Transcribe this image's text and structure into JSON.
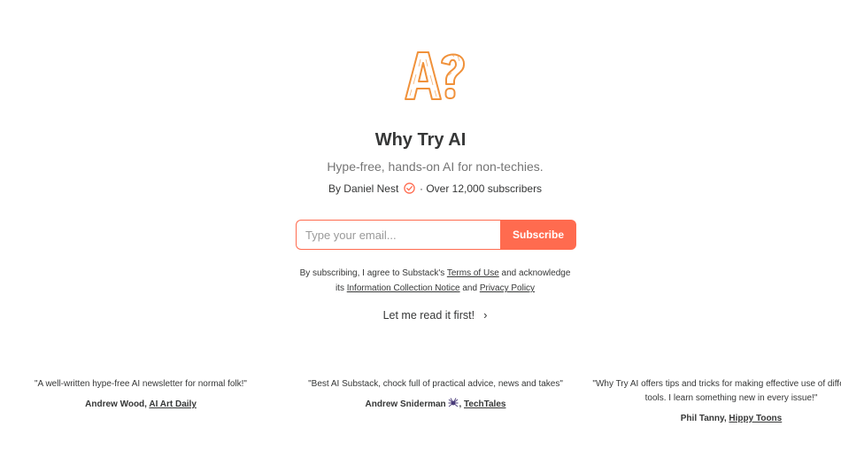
{
  "publication": {
    "title": "Why Try AI",
    "subtitle": "Hype-free, hands-on AI for non-techies.",
    "byline_prefix": "By Daniel Nest",
    "byline_suffix": "· Over 12,000 subscribers",
    "accent_color": "#ff6b4f"
  },
  "form": {
    "email_placeholder": "Type your email...",
    "subscribe_label": "Subscribe"
  },
  "terms": {
    "part1": "By subscribing, I agree to Substack's ",
    "terms_link": "Terms of Use",
    "part2": " and acknowledge",
    "part3": "its ",
    "notice_link": "Information Collection Notice",
    "part4": " and ",
    "privacy_link": "Privacy Policy"
  },
  "read_first": {
    "label": "Let me read it first!",
    "icon": "chevron-right-icon"
  },
  "testimonials": [
    {
      "quote": "\"A well-written hype-free AI newsletter for normal folk!\"",
      "author": "Andrew Wood",
      "source": "AI Art Daily"
    },
    {
      "quote": "\"Best AI Substack, chock full of practical advice, news and takes\"",
      "author": "Andrew Sniderman",
      "source": "TechTales"
    },
    {
      "quote": "\"Why Try AI offers tips and tricks for making effective use of different AI tools. I learn something new in every issue!\"",
      "author": "Phil Tanny",
      "source": "Hippy Toons"
    }
  ]
}
